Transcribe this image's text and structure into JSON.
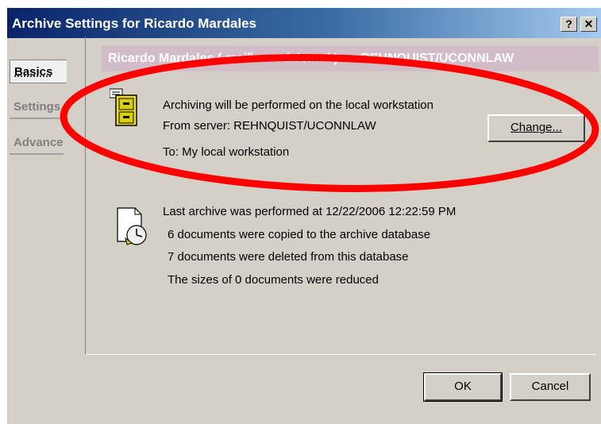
{
  "window": {
    "title": "Archive Settings for Ricardo Mardales",
    "help_glyph": "?",
    "close_glyph": "✕"
  },
  "tabs": [
    {
      "label": "Basics",
      "selected": true
    },
    {
      "label": "Settings",
      "selected": false
    },
    {
      "label": "Advanced",
      "selected": false
    }
  ],
  "header": {
    "text": "Ricardo Mardales ( mail\\rmardale.nsf ) on REHNQUIST/UCONNLAW"
  },
  "location": {
    "line1": "Archiving will be performed on the local workstation",
    "line2": "From server: REHNQUIST/UCONNLAW",
    "line3": "To: My local workstation",
    "change_label": "Change..."
  },
  "last_archive": {
    "line1": "Last archive was performed at 12/22/2006 12:22:59 PM",
    "line2": "6 documents were copied to the archive database",
    "line3": "7 documents were deleted from this database",
    "line4": "The sizes of 0 documents were reduced"
  },
  "footer": {
    "ok_label": "OK",
    "cancel_label": "Cancel"
  },
  "colors": {
    "annotation": "#ff0000",
    "titlebar": "#0a246a",
    "header_band": "#d2bcc8"
  }
}
